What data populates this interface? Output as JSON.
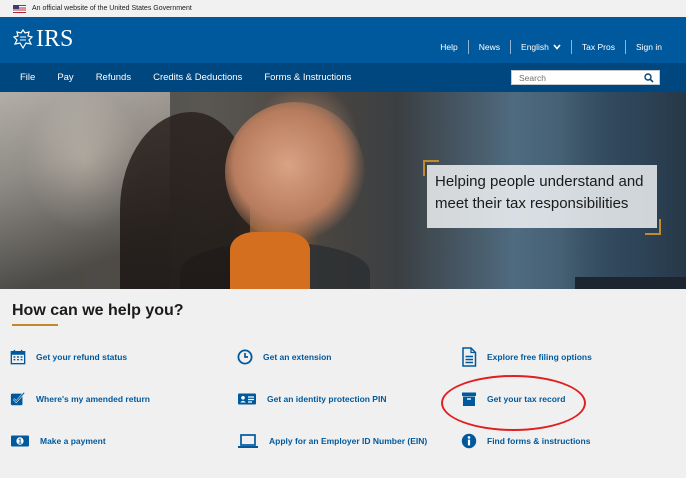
{
  "gov_banner": {
    "text": "An official website of the United States Government"
  },
  "header": {
    "logo_text": "IRS",
    "utility": {
      "help": "Help",
      "news": "News",
      "language": "English",
      "tax_pros": "Tax Pros",
      "sign_in": "Sign in"
    }
  },
  "nav": {
    "items": [
      "File",
      "Pay",
      "Refunds",
      "Credits & Deductions",
      "Forms & Instructions"
    ],
    "search_placeholder": "Search"
  },
  "hero": {
    "headline_line1": "Helping people understand and",
    "headline_line2": "meet their tax responsibilities"
  },
  "help": {
    "title": "How can we help you?",
    "links": [
      {
        "label": "Get your refund status",
        "icon": "calendar-icon"
      },
      {
        "label": "Get an extension",
        "icon": "clock-icon"
      },
      {
        "label": "Explore free filing options",
        "icon": "document-icon"
      },
      {
        "label": "Where's my amended return",
        "icon": "checkbox-icon"
      },
      {
        "label": "Get an identity protection PIN",
        "icon": "id-card-icon"
      },
      {
        "label": "Get your tax record",
        "icon": "archive-box-icon"
      },
      {
        "label": "Make a payment",
        "icon": "money-bill-icon"
      },
      {
        "label": "Apply for an Employer ID Number (EIN)",
        "icon": "laptop-icon"
      },
      {
        "label": "Find forms & instructions",
        "icon": "info-icon"
      }
    ]
  },
  "colors": {
    "header_blue": "#00599c",
    "nav_blue": "#00467f",
    "link_blue": "#00599c",
    "accent_gold": "#c08a2d",
    "highlight_red": "#e02020"
  }
}
